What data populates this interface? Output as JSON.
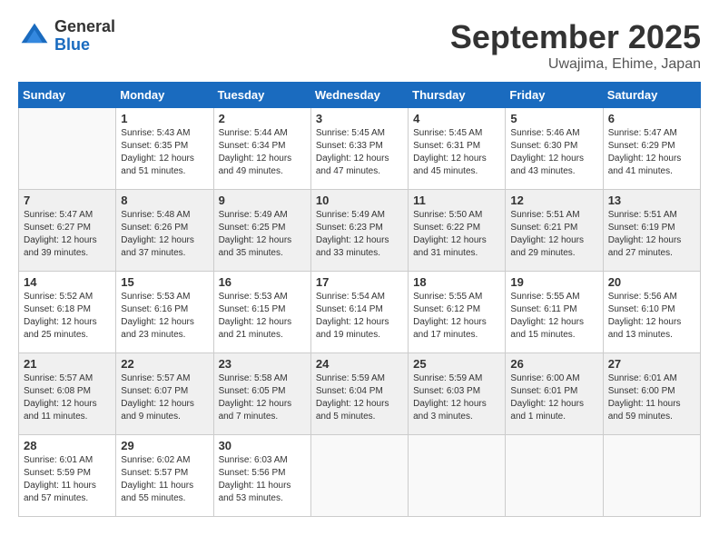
{
  "logo": {
    "general": "General",
    "blue": "Blue"
  },
  "header": {
    "month": "September 2025",
    "location": "Uwajima, Ehime, Japan"
  },
  "weekdays": [
    "Sunday",
    "Monday",
    "Tuesday",
    "Wednesday",
    "Thursday",
    "Friday",
    "Saturday"
  ],
  "weeks": [
    [
      {
        "day": "",
        "info": ""
      },
      {
        "day": "1",
        "info": "Sunrise: 5:43 AM\nSunset: 6:35 PM\nDaylight: 12 hours\nand 51 minutes."
      },
      {
        "day": "2",
        "info": "Sunrise: 5:44 AM\nSunset: 6:34 PM\nDaylight: 12 hours\nand 49 minutes."
      },
      {
        "day": "3",
        "info": "Sunrise: 5:45 AM\nSunset: 6:33 PM\nDaylight: 12 hours\nand 47 minutes."
      },
      {
        "day": "4",
        "info": "Sunrise: 5:45 AM\nSunset: 6:31 PM\nDaylight: 12 hours\nand 45 minutes."
      },
      {
        "day": "5",
        "info": "Sunrise: 5:46 AM\nSunset: 6:30 PM\nDaylight: 12 hours\nand 43 minutes."
      },
      {
        "day": "6",
        "info": "Sunrise: 5:47 AM\nSunset: 6:29 PM\nDaylight: 12 hours\nand 41 minutes."
      }
    ],
    [
      {
        "day": "7",
        "info": "Sunrise: 5:47 AM\nSunset: 6:27 PM\nDaylight: 12 hours\nand 39 minutes."
      },
      {
        "day": "8",
        "info": "Sunrise: 5:48 AM\nSunset: 6:26 PM\nDaylight: 12 hours\nand 37 minutes."
      },
      {
        "day": "9",
        "info": "Sunrise: 5:49 AM\nSunset: 6:25 PM\nDaylight: 12 hours\nand 35 minutes."
      },
      {
        "day": "10",
        "info": "Sunrise: 5:49 AM\nSunset: 6:23 PM\nDaylight: 12 hours\nand 33 minutes."
      },
      {
        "day": "11",
        "info": "Sunrise: 5:50 AM\nSunset: 6:22 PM\nDaylight: 12 hours\nand 31 minutes."
      },
      {
        "day": "12",
        "info": "Sunrise: 5:51 AM\nSunset: 6:21 PM\nDaylight: 12 hours\nand 29 minutes."
      },
      {
        "day": "13",
        "info": "Sunrise: 5:51 AM\nSunset: 6:19 PM\nDaylight: 12 hours\nand 27 minutes."
      }
    ],
    [
      {
        "day": "14",
        "info": "Sunrise: 5:52 AM\nSunset: 6:18 PM\nDaylight: 12 hours\nand 25 minutes."
      },
      {
        "day": "15",
        "info": "Sunrise: 5:53 AM\nSunset: 6:16 PM\nDaylight: 12 hours\nand 23 minutes."
      },
      {
        "day": "16",
        "info": "Sunrise: 5:53 AM\nSunset: 6:15 PM\nDaylight: 12 hours\nand 21 minutes."
      },
      {
        "day": "17",
        "info": "Sunrise: 5:54 AM\nSunset: 6:14 PM\nDaylight: 12 hours\nand 19 minutes."
      },
      {
        "day": "18",
        "info": "Sunrise: 5:55 AM\nSunset: 6:12 PM\nDaylight: 12 hours\nand 17 minutes."
      },
      {
        "day": "19",
        "info": "Sunrise: 5:55 AM\nSunset: 6:11 PM\nDaylight: 12 hours\nand 15 minutes."
      },
      {
        "day": "20",
        "info": "Sunrise: 5:56 AM\nSunset: 6:10 PM\nDaylight: 12 hours\nand 13 minutes."
      }
    ],
    [
      {
        "day": "21",
        "info": "Sunrise: 5:57 AM\nSunset: 6:08 PM\nDaylight: 12 hours\nand 11 minutes."
      },
      {
        "day": "22",
        "info": "Sunrise: 5:57 AM\nSunset: 6:07 PM\nDaylight: 12 hours\nand 9 minutes."
      },
      {
        "day": "23",
        "info": "Sunrise: 5:58 AM\nSunset: 6:05 PM\nDaylight: 12 hours\nand 7 minutes."
      },
      {
        "day": "24",
        "info": "Sunrise: 5:59 AM\nSunset: 6:04 PM\nDaylight: 12 hours\nand 5 minutes."
      },
      {
        "day": "25",
        "info": "Sunrise: 5:59 AM\nSunset: 6:03 PM\nDaylight: 12 hours\nand 3 minutes."
      },
      {
        "day": "26",
        "info": "Sunrise: 6:00 AM\nSunset: 6:01 PM\nDaylight: 12 hours\nand 1 minute."
      },
      {
        "day": "27",
        "info": "Sunrise: 6:01 AM\nSunset: 6:00 PM\nDaylight: 11 hours\nand 59 minutes."
      }
    ],
    [
      {
        "day": "28",
        "info": "Sunrise: 6:01 AM\nSunset: 5:59 PM\nDaylight: 11 hours\nand 57 minutes."
      },
      {
        "day": "29",
        "info": "Sunrise: 6:02 AM\nSunset: 5:57 PM\nDaylight: 11 hours\nand 55 minutes."
      },
      {
        "day": "30",
        "info": "Sunrise: 6:03 AM\nSunset: 5:56 PM\nDaylight: 11 hours\nand 53 minutes."
      },
      {
        "day": "",
        "info": ""
      },
      {
        "day": "",
        "info": ""
      },
      {
        "day": "",
        "info": ""
      },
      {
        "day": "",
        "info": ""
      }
    ]
  ]
}
